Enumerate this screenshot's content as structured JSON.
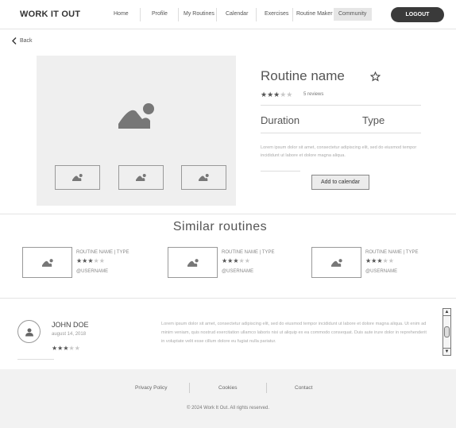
{
  "header": {
    "logo": "WORK IT OUT",
    "nav": [
      "Home",
      "Profile",
      "My Routines",
      "Calendar",
      "Exercises",
      "Routine Maker",
      "Community"
    ],
    "logout": "LOGOUT"
  },
  "back_label": "Back",
  "routine": {
    "name": "Routine name",
    "rating": 3,
    "rating_max": 5,
    "reviews": "5 reviews",
    "duration_label": "Duration",
    "type_label": "Type",
    "description": "Lorem ipsum dolor sit amet, consectetur adipiscing elit, sed do eiusmod tempor incididunt ut labore et dolore magna aliqua.",
    "add_to_calendar": "Add to calendar"
  },
  "similar": {
    "title": "Similar routines",
    "cards": [
      {
        "name": "ROUTINE NAME | TYPE",
        "rating": 3,
        "user": "@USERNAME"
      },
      {
        "name": "ROUTINE NAME | TYPE",
        "rating": 3,
        "user": "@USERNAME"
      },
      {
        "name": "ROUTINE NAME | TYPE",
        "rating": 3,
        "user": "@USERNAME"
      }
    ]
  },
  "review": {
    "name": "JOHN DOE",
    "date": "august 14, 2018",
    "rating": 3,
    "text": "Lorem ipsum dolor sit amet, consectetur adipiscing elit, sed do eiusmod tempor incididunt ut labore et dolore magna aliqua. Ut enim ad minim veniam, quis nostrud exercitation ullamco laboris nisi ut aliquip ex ea commodo consequat. Duis aute irure dolor in reprehenderit in voluptate velit esse cillum dolore eu fugiat nulla pariatur."
  },
  "footer": {
    "links": [
      "Privacy Policy",
      "Cookies",
      "Contact"
    ],
    "copyright": "© 2024 Work It Out.  All rights reserved."
  }
}
